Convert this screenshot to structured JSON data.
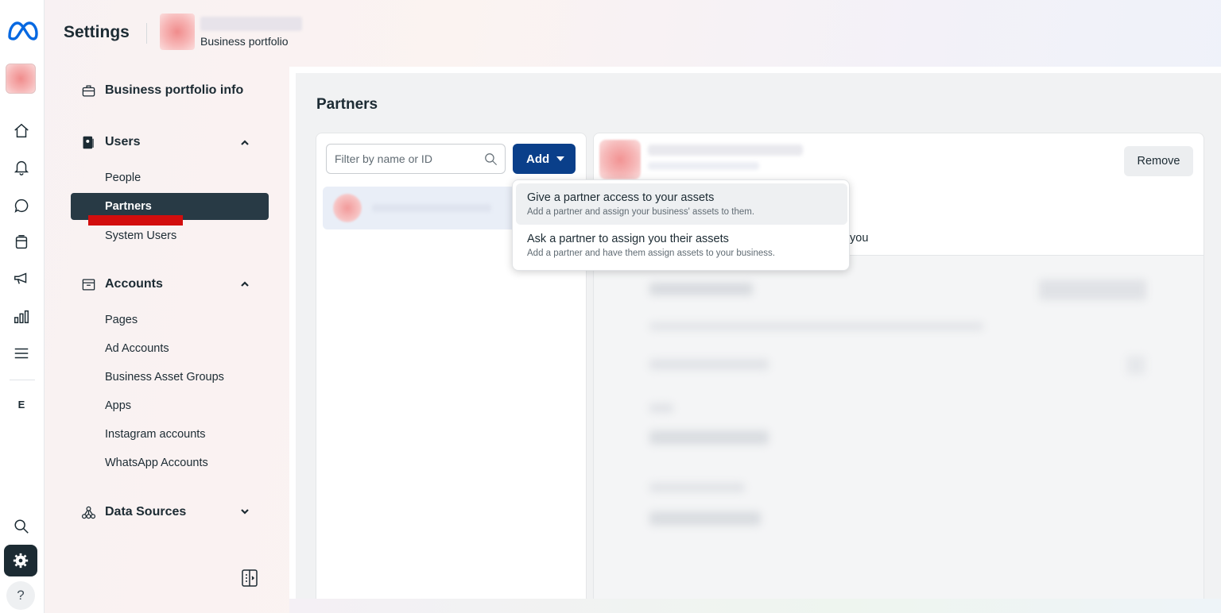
{
  "header": {
    "title": "Settings",
    "subtitle": "Business portfolio"
  },
  "rail": {
    "letter": "E",
    "help": "?"
  },
  "sidebar": {
    "business_info": "Business portfolio info",
    "users": {
      "label": "Users",
      "items": [
        "People",
        "Partners",
        "System Users"
      ],
      "active": "Partners"
    },
    "accounts": {
      "label": "Accounts",
      "items": [
        "Pages",
        "Ad Accounts",
        "Business Asset Groups",
        "Apps",
        "Instagram accounts",
        "WhatsApp Accounts"
      ]
    },
    "data_sources": {
      "label": "Data Sources"
    }
  },
  "main": {
    "title": "Partners",
    "filter_placeholder": "Filter by name or ID",
    "add_label": "Add",
    "remove_label": "Remove",
    "detail_fragment": "you"
  },
  "dropdown": {
    "items": [
      {
        "title": "Give a partner access to your assets",
        "desc": "Add a partner and assign your business' assets to them."
      },
      {
        "title": "Ask a partner to assign you their assets",
        "desc": "Add a partner and have them assign assets to your business."
      }
    ]
  },
  "colors": {
    "primary_button": "#0a3f8a",
    "active_nav": "#283a45",
    "highlight_underline": "#d20d0d"
  }
}
